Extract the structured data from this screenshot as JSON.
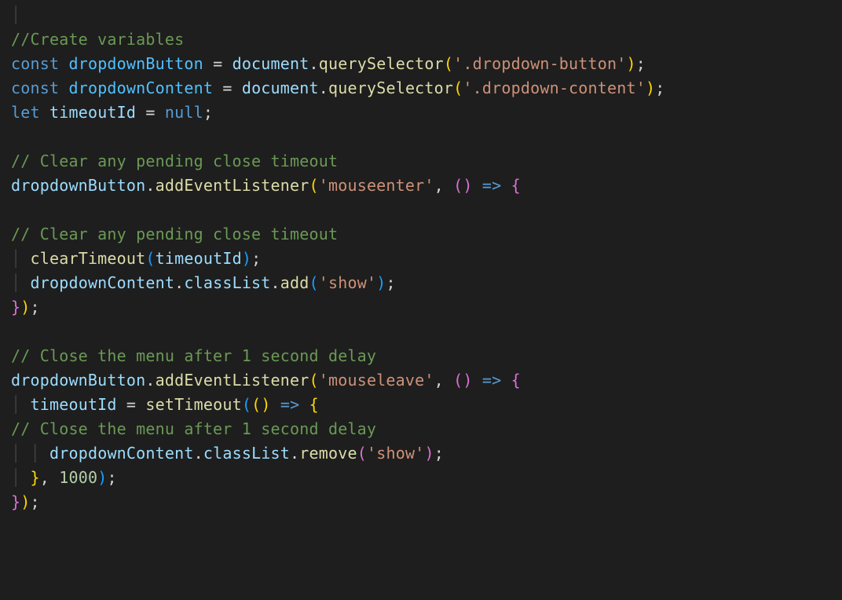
{
  "code": {
    "c1": "//Create variables",
    "kw_const": "const",
    "kw_let": "let",
    "v_dropdownButton": "dropdownButton",
    "v_dropdownContent": "dropdownContent",
    "v_timeoutId": "timeoutId",
    "v_document": "document",
    "fn_querySelector": "querySelector",
    "fn_addEventListener": "addEventListener",
    "fn_clearTimeout": "clearTimeout",
    "fn_setTimeout": "setTimeout",
    "fn_add": "add",
    "fn_remove": "remove",
    "p_classList": "classList",
    "s_dropdown_button": "'.dropdown-button'",
    "s_dropdown_content": "'.dropdown-content'",
    "s_mouseenter": "'mouseenter'",
    "s_mouseleave": "'mouseleave'",
    "s_show": "'show'",
    "n_null": "null",
    "n_1000": "1000",
    "c2": "// Clear any pending close timeout",
    "c3": "// Clear any pending close timeout",
    "c4": "// Close the menu after 1 second delay",
    "c5": "// Close the menu after 1 second delay",
    "eq": " = ",
    "dot": ".",
    "semi": ";",
    "comma": ", ",
    "arrow": "=>",
    "empty_parens_open": "(",
    "empty_parens_close": ")",
    "brace_open": "{",
    "brace_close": "}",
    "guide": "│"
  }
}
